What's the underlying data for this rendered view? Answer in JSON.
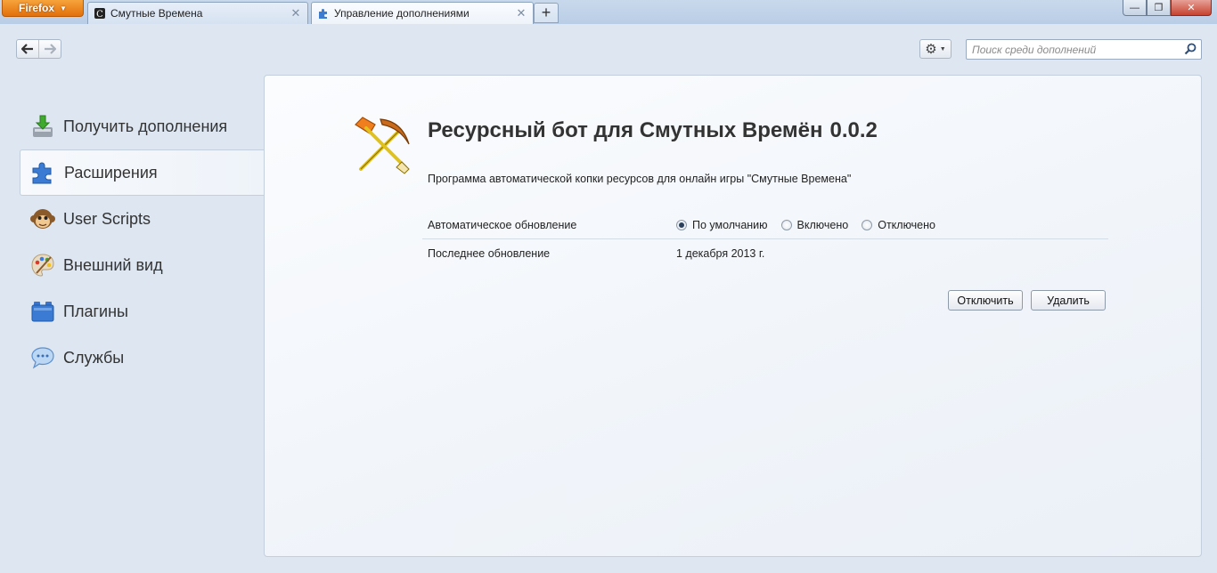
{
  "browser": {
    "menu_button": "Firefox",
    "tabs": [
      {
        "title": "Смутные Времена",
        "selected": false
      },
      {
        "title": "Управление дополнениями",
        "selected": true
      }
    ],
    "new_tab": "+",
    "window_controls": {
      "minimize": "—",
      "maximize": "❐",
      "close": "✕"
    }
  },
  "toolbar": {
    "back": "🡐",
    "forward": "🡒",
    "gear": "⚙",
    "search_placeholder": "Поиск среди дополнений"
  },
  "sidebar": {
    "items": [
      {
        "label": "Получить дополнения",
        "icon": "download-icon"
      },
      {
        "label": "Расширения",
        "icon": "puzzle-icon",
        "selected": true
      },
      {
        "label": "User Scripts",
        "icon": "monkey-icon"
      },
      {
        "label": "Внешний вид",
        "icon": "palette-icon"
      },
      {
        "label": "Плагины",
        "icon": "lego-block-icon"
      },
      {
        "label": "Службы",
        "icon": "chat-bubble-icon"
      }
    ]
  },
  "addon": {
    "name": "Ресурсный бот для Смутных Времён",
    "version": "0.0.2",
    "description": "Программа автоматической копки ресурсов для онлайн игры \"Смутные Времена\"",
    "auto_update": {
      "label": "Автоматическое обновление",
      "options": [
        "По умолчанию",
        "Включено",
        "Отключено"
      ],
      "selected": "По умолчанию"
    },
    "last_update": {
      "label": "Последнее обновление",
      "value": "1 декабря 2013 г."
    },
    "buttons": {
      "disable": "Отключить",
      "remove": "Удалить"
    }
  }
}
